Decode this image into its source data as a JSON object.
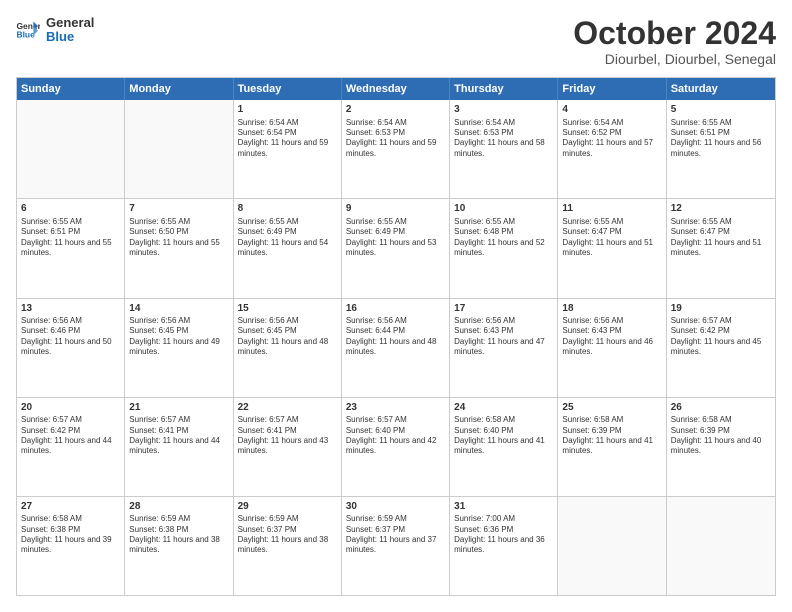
{
  "logo": {
    "line1": "General",
    "line2": "Blue"
  },
  "title": "October 2024",
  "subtitle": "Diourbel, Diourbel, Senegal",
  "header_days": [
    "Sunday",
    "Monday",
    "Tuesday",
    "Wednesday",
    "Thursday",
    "Friday",
    "Saturday"
  ],
  "weeks": [
    [
      {
        "day": "",
        "empty": true,
        "sunrise": "",
        "sunset": "",
        "daylight": ""
      },
      {
        "day": "",
        "empty": true,
        "sunrise": "",
        "sunset": "",
        "daylight": ""
      },
      {
        "day": "1",
        "sunrise": "Sunrise: 6:54 AM",
        "sunset": "Sunset: 6:54 PM",
        "daylight": "Daylight: 11 hours and 59 minutes."
      },
      {
        "day": "2",
        "sunrise": "Sunrise: 6:54 AM",
        "sunset": "Sunset: 6:53 PM",
        "daylight": "Daylight: 11 hours and 59 minutes."
      },
      {
        "day": "3",
        "sunrise": "Sunrise: 6:54 AM",
        "sunset": "Sunset: 6:53 PM",
        "daylight": "Daylight: 11 hours and 58 minutes."
      },
      {
        "day": "4",
        "sunrise": "Sunrise: 6:54 AM",
        "sunset": "Sunset: 6:52 PM",
        "daylight": "Daylight: 11 hours and 57 minutes."
      },
      {
        "day": "5",
        "sunrise": "Sunrise: 6:55 AM",
        "sunset": "Sunset: 6:51 PM",
        "daylight": "Daylight: 11 hours and 56 minutes."
      }
    ],
    [
      {
        "day": "6",
        "sunrise": "Sunrise: 6:55 AM",
        "sunset": "Sunset: 6:51 PM",
        "daylight": "Daylight: 11 hours and 55 minutes."
      },
      {
        "day": "7",
        "sunrise": "Sunrise: 6:55 AM",
        "sunset": "Sunset: 6:50 PM",
        "daylight": "Daylight: 11 hours and 55 minutes."
      },
      {
        "day": "8",
        "sunrise": "Sunrise: 6:55 AM",
        "sunset": "Sunset: 6:49 PM",
        "daylight": "Daylight: 11 hours and 54 minutes."
      },
      {
        "day": "9",
        "sunrise": "Sunrise: 6:55 AM",
        "sunset": "Sunset: 6:49 PM",
        "daylight": "Daylight: 11 hours and 53 minutes."
      },
      {
        "day": "10",
        "sunrise": "Sunrise: 6:55 AM",
        "sunset": "Sunset: 6:48 PM",
        "daylight": "Daylight: 11 hours and 52 minutes."
      },
      {
        "day": "11",
        "sunrise": "Sunrise: 6:55 AM",
        "sunset": "Sunset: 6:47 PM",
        "daylight": "Daylight: 11 hours and 51 minutes."
      },
      {
        "day": "12",
        "sunrise": "Sunrise: 6:55 AM",
        "sunset": "Sunset: 6:47 PM",
        "daylight": "Daylight: 11 hours and 51 minutes."
      }
    ],
    [
      {
        "day": "13",
        "sunrise": "Sunrise: 6:56 AM",
        "sunset": "Sunset: 6:46 PM",
        "daylight": "Daylight: 11 hours and 50 minutes."
      },
      {
        "day": "14",
        "sunrise": "Sunrise: 6:56 AM",
        "sunset": "Sunset: 6:45 PM",
        "daylight": "Daylight: 11 hours and 49 minutes."
      },
      {
        "day": "15",
        "sunrise": "Sunrise: 6:56 AM",
        "sunset": "Sunset: 6:45 PM",
        "daylight": "Daylight: 11 hours and 48 minutes."
      },
      {
        "day": "16",
        "sunrise": "Sunrise: 6:56 AM",
        "sunset": "Sunset: 6:44 PM",
        "daylight": "Daylight: 11 hours and 48 minutes."
      },
      {
        "day": "17",
        "sunrise": "Sunrise: 6:56 AM",
        "sunset": "Sunset: 6:43 PM",
        "daylight": "Daylight: 11 hours and 47 minutes."
      },
      {
        "day": "18",
        "sunrise": "Sunrise: 6:56 AM",
        "sunset": "Sunset: 6:43 PM",
        "daylight": "Daylight: 11 hours and 46 minutes."
      },
      {
        "day": "19",
        "sunrise": "Sunrise: 6:57 AM",
        "sunset": "Sunset: 6:42 PM",
        "daylight": "Daylight: 11 hours and 45 minutes."
      }
    ],
    [
      {
        "day": "20",
        "sunrise": "Sunrise: 6:57 AM",
        "sunset": "Sunset: 6:42 PM",
        "daylight": "Daylight: 11 hours and 44 minutes."
      },
      {
        "day": "21",
        "sunrise": "Sunrise: 6:57 AM",
        "sunset": "Sunset: 6:41 PM",
        "daylight": "Daylight: 11 hours and 44 minutes."
      },
      {
        "day": "22",
        "sunrise": "Sunrise: 6:57 AM",
        "sunset": "Sunset: 6:41 PM",
        "daylight": "Daylight: 11 hours and 43 minutes."
      },
      {
        "day": "23",
        "sunrise": "Sunrise: 6:57 AM",
        "sunset": "Sunset: 6:40 PM",
        "daylight": "Daylight: 11 hours and 42 minutes."
      },
      {
        "day": "24",
        "sunrise": "Sunrise: 6:58 AM",
        "sunset": "Sunset: 6:40 PM",
        "daylight": "Daylight: 11 hours and 41 minutes."
      },
      {
        "day": "25",
        "sunrise": "Sunrise: 6:58 AM",
        "sunset": "Sunset: 6:39 PM",
        "daylight": "Daylight: 11 hours and 41 minutes."
      },
      {
        "day": "26",
        "sunrise": "Sunrise: 6:58 AM",
        "sunset": "Sunset: 6:39 PM",
        "daylight": "Daylight: 11 hours and 40 minutes."
      }
    ],
    [
      {
        "day": "27",
        "sunrise": "Sunrise: 6:58 AM",
        "sunset": "Sunset: 6:38 PM",
        "daylight": "Daylight: 11 hours and 39 minutes."
      },
      {
        "day": "28",
        "sunrise": "Sunrise: 6:59 AM",
        "sunset": "Sunset: 6:38 PM",
        "daylight": "Daylight: 11 hours and 38 minutes."
      },
      {
        "day": "29",
        "sunrise": "Sunrise: 6:59 AM",
        "sunset": "Sunset: 6:37 PM",
        "daylight": "Daylight: 11 hours and 38 minutes."
      },
      {
        "day": "30",
        "sunrise": "Sunrise: 6:59 AM",
        "sunset": "Sunset: 6:37 PM",
        "daylight": "Daylight: 11 hours and 37 minutes."
      },
      {
        "day": "31",
        "sunrise": "Sunrise: 7:00 AM",
        "sunset": "Sunset: 6:36 PM",
        "daylight": "Daylight: 11 hours and 36 minutes."
      },
      {
        "day": "",
        "empty": true,
        "sunrise": "",
        "sunset": "",
        "daylight": ""
      },
      {
        "day": "",
        "empty": true,
        "sunrise": "",
        "sunset": "",
        "daylight": ""
      }
    ]
  ]
}
